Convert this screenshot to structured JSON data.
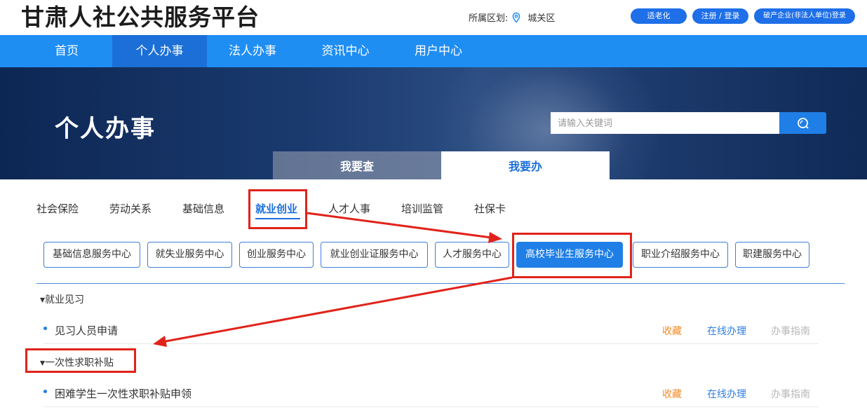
{
  "header": {
    "site_title": "甘肃人社公共服务平台",
    "region_label": "所属区划:",
    "region_value": "城关区",
    "buttons": [
      "适老化",
      "注册 / 登录",
      "破产企业(非法人单位)登录"
    ]
  },
  "nav": {
    "items": [
      "首页",
      "个人办事",
      "法人办事",
      "资讯中心",
      "用户中心"
    ],
    "active": "个人办事"
  },
  "banner": {
    "title": "个人办事",
    "search_placeholder": "请输入关键词",
    "tabs": [
      "我要查",
      "我要办"
    ],
    "active_tab": "我要办"
  },
  "categories": {
    "items": [
      "社会保险",
      "劳动关系",
      "基础信息",
      "就业创业",
      "人才人事",
      "培训监管",
      "社保卡"
    ],
    "active": "就业创业"
  },
  "sub_centers": {
    "items": [
      "基础信息服务中心",
      "就失业服务中心",
      "创业服务中心",
      "就业创业证服务中心",
      "人才服务中心",
      "高校毕业生服务中心",
      "职业介绍服务中心",
      "职建服务中心"
    ],
    "active": "高校毕业生服务中心"
  },
  "sections": [
    {
      "title": "▾就业见习",
      "items": [
        {
          "name": "见习人员申请",
          "actions": [
            "收藏",
            "在线办理",
            "办事指南"
          ]
        }
      ]
    },
    {
      "title": "▾一次性求职补贴",
      "items": [
        {
          "name": "困难学生一次性求职补贴申领",
          "actions": [
            "收藏",
            "在线办理",
            "办事指南"
          ]
        }
      ]
    }
  ],
  "colors": {
    "nav_bg": "#1f8ef3",
    "nav_active": "#1b6fd6",
    "accent": "#1f7fe6",
    "annotation": "#e0231a",
    "favorite": "#f08a24"
  }
}
